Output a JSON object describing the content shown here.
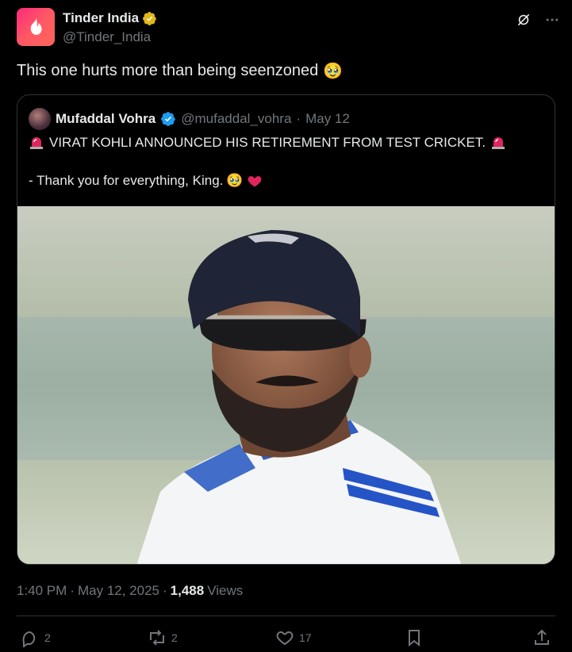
{
  "author": {
    "display_name": "Tinder India",
    "handle": "@Tinder_India",
    "avatar_icon": "tinder-flame-icon",
    "badge": "gold-verified-badge-icon"
  },
  "tweet": {
    "text": "This one hurts more than being seenzoned",
    "emoji": "🥹"
  },
  "quoted": {
    "display_name": "Mufaddal Vohra",
    "handle": "@mufaddal_vohra",
    "separator": "·",
    "date": "May 12",
    "line1": "VIRAT KOHLI ANNOUNCED HIS RETIREMENT FROM TEST CRICKET.",
    "line2": "- Thank you for everything, King.",
    "line2_emoji": "🥹",
    "image_icon": "cricketer-photo"
  },
  "meta": {
    "time": "1:40 PM",
    "separator1": "·",
    "date": "May 12, 2025",
    "separator2": "·",
    "views_count": "1,488",
    "views_label": "Views"
  },
  "actions": {
    "replies": "2",
    "reposts": "2",
    "likes": "17"
  },
  "colors": {
    "background": "#000000",
    "text": "#e7e9ea",
    "muted": "#71767b",
    "border": "#2f3336",
    "verified_blue": "#1d9bf0",
    "verified_gold": "#e2b719",
    "tinder": "#fd297b"
  }
}
